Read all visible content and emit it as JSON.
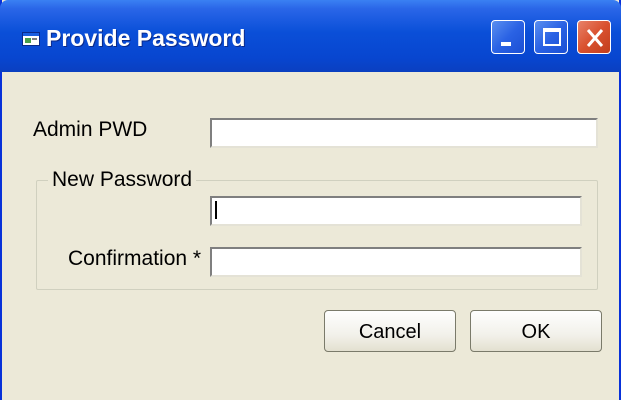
{
  "window": {
    "title": "Provide Password",
    "icon": "app-window-icon",
    "controls": [
      "minimize-icon",
      "maximize-icon",
      "close-icon"
    ],
    "colors": {
      "titlebar": "#0a4fd8",
      "body": "#ece9d8",
      "close": "#d9512f"
    }
  },
  "form": {
    "admin_pwd_label": "Admin PWD",
    "admin_pwd_value": "",
    "group_label": "New Password",
    "new_password_value": "",
    "confirmation_label": "Confirmation *",
    "confirmation_value": ""
  },
  "buttons": {
    "cancel_label": "Cancel",
    "ok_label": "OK"
  }
}
